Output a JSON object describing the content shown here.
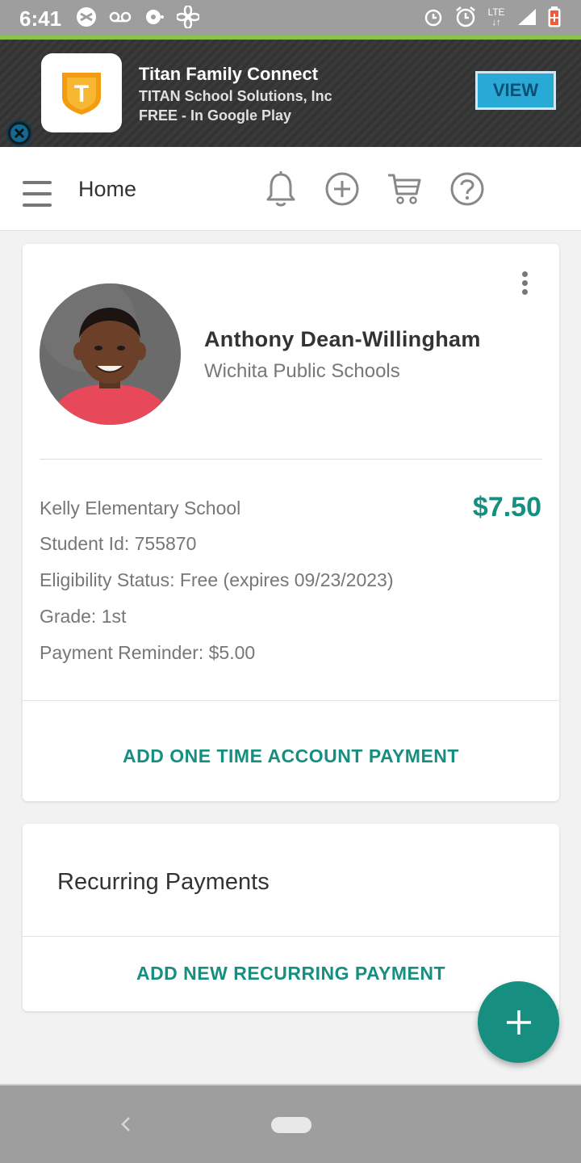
{
  "status_bar": {
    "time": "6:41",
    "network": "LTE"
  },
  "ad_banner": {
    "app_name": "Titan Family Connect",
    "publisher": "TITAN School Solutions, Inc",
    "price_store": "FREE - In Google Play",
    "view_label": "VIEW",
    "logo_letter": "T"
  },
  "app_bar": {
    "title": "Home"
  },
  "student": {
    "name": "Anthony Dean-Willingham",
    "district": "Wichita Public Schools",
    "school": "Kelly Elementary School",
    "balance": "$7.50",
    "student_id": "Student Id: 755870",
    "eligibility": "Eligibility Status: Free (expires 09/23/2023)",
    "grade": "Grade: 1st",
    "payment_reminder": "Payment Reminder: $5.00",
    "action_label": "ADD ONE TIME ACCOUNT PAYMENT"
  },
  "recurring": {
    "title": "Recurring Payments",
    "action_label": "ADD NEW RECURRING PAYMENT"
  },
  "colors": {
    "accent": "#178f80",
    "ad_button": "#29a9d6",
    "logo_orange": "#f39c12"
  }
}
